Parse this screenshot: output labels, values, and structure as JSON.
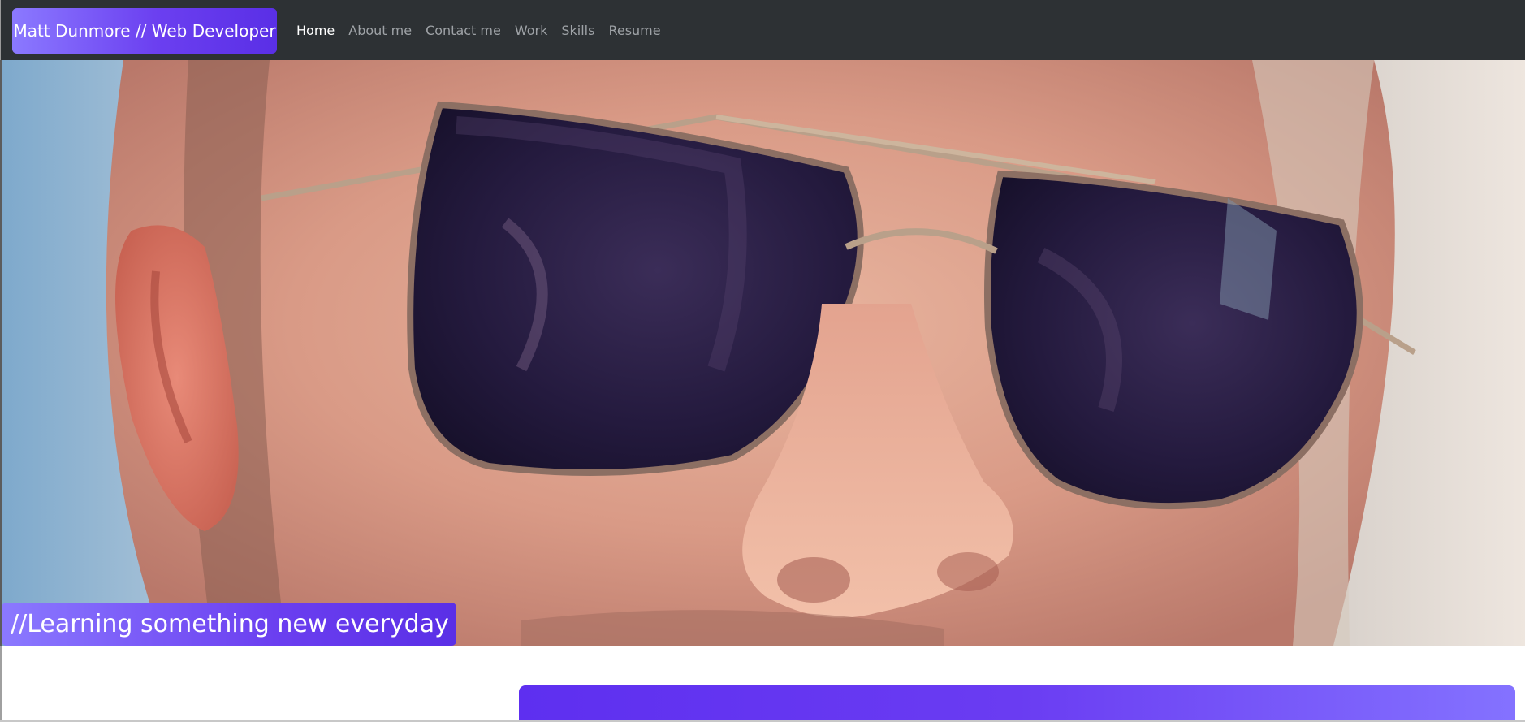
{
  "navbar": {
    "brand": "Matt Dunmore // Web Developer",
    "links": [
      {
        "label": "Home",
        "active": true
      },
      {
        "label": "About me",
        "active": false
      },
      {
        "label": "Contact me",
        "active": false
      },
      {
        "label": "Work",
        "active": false
      },
      {
        "label": "Skills",
        "active": false
      },
      {
        "label": "Resume",
        "active": false
      }
    ]
  },
  "hero": {
    "tagline": "//Learning something new everyday"
  },
  "colors": {
    "navbar_bg": "#2d3134",
    "accent_start": "#8b79ff",
    "accent_end": "#5a2fe6",
    "nav_link": "#9ea2a6",
    "nav_link_active": "#ffffff"
  }
}
